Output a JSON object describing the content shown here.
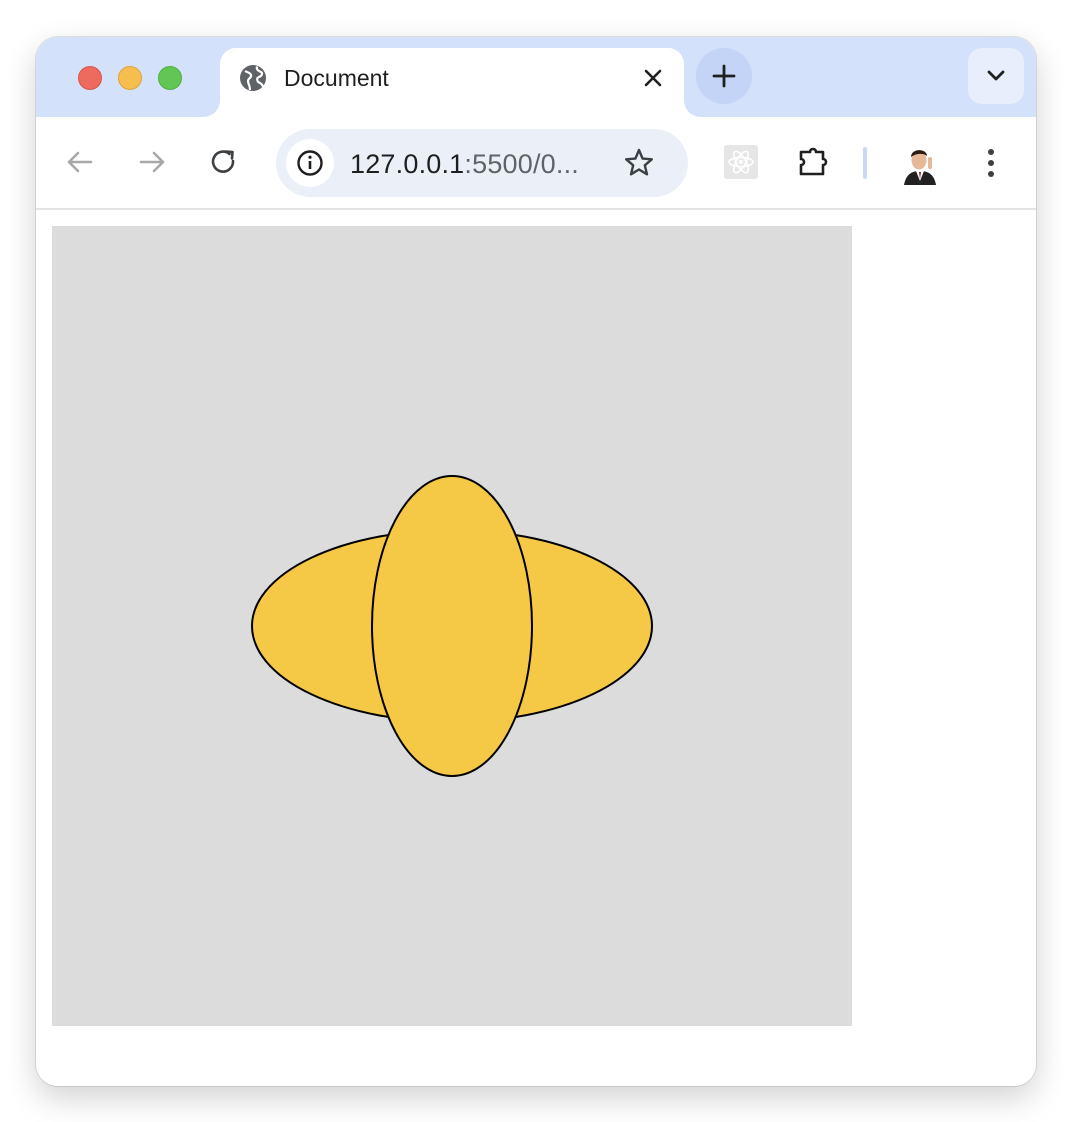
{
  "window": {
    "traffic_lights": [
      "close",
      "minimize",
      "zoom"
    ]
  },
  "tab": {
    "title": "Document",
    "favicon": "globe-icon",
    "close_icon": "close-icon"
  },
  "tabstrip": {
    "new_tab_icon": "plus-icon",
    "tab_list_icon": "chevron-down-icon"
  },
  "toolbar": {
    "back_icon": "arrow-left-icon",
    "forward_icon": "arrow-right-icon",
    "reload_icon": "reload-icon",
    "site_info_icon": "info-icon",
    "url_host": "127.0.0.1",
    "url_rest": ":5500/0...",
    "bookmark_icon": "star-icon",
    "extensions": [
      "react-devtools-icon",
      "puzzle-icon"
    ],
    "profile_icon": "avatar",
    "menu_icon": "more-vert-icon"
  },
  "page": {
    "canvas_background": "#dcdcdc",
    "shapes": [
      {
        "type": "ellipse",
        "fill": "#f5c846",
        "stroke": "#000000"
      },
      {
        "type": "ellipse",
        "fill": "#f5c846",
        "stroke": "#000000"
      }
    ]
  },
  "colors": {
    "tabstrip": "#d4e1fb",
    "omnibox": "#ebf0f8",
    "accent_yellow": "#f5c846",
    "canvas": "#dcdcdc"
  }
}
